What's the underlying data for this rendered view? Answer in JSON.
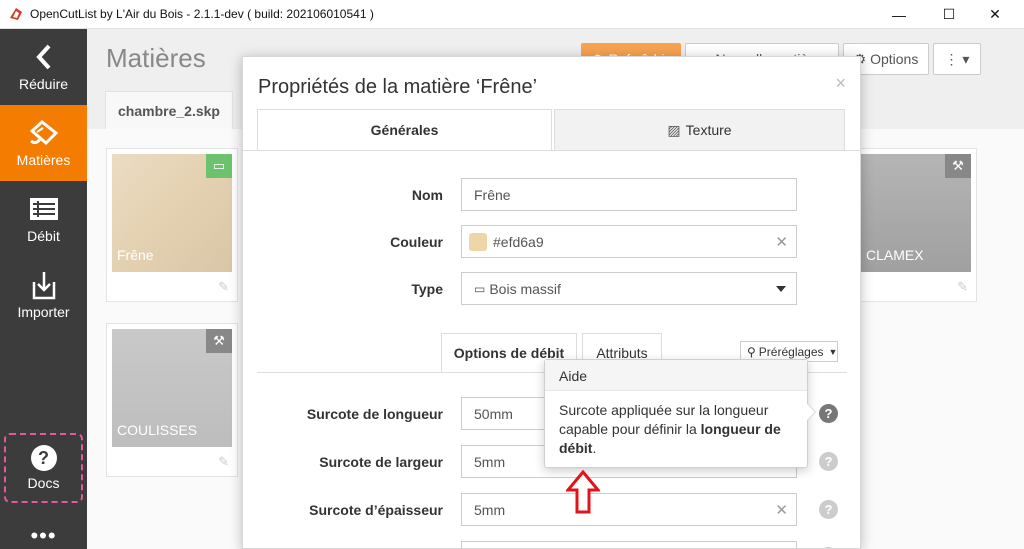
{
  "window": {
    "title": "OpenCutList by L'Air du Bois - 2.1.1-dev ( build: 202106010541 )",
    "controls": {
      "minimize": "—",
      "maximize": "☐",
      "close": "✕"
    }
  },
  "sidebar": {
    "items": [
      {
        "label": "Réduire",
        "icon": "chevron-left-icon"
      },
      {
        "label": "Matières",
        "icon": "materials-icon"
      },
      {
        "label": "Débit",
        "icon": "list-icon"
      },
      {
        "label": "Importer",
        "icon": "import-icon"
      }
    ],
    "docs_label": "Docs",
    "more_label": "•••"
  },
  "main": {
    "title": "Matières",
    "file_tab": "chambre_2.skp",
    "buttons": {
      "refresh": "⟳ Rafraîchir",
      "new_material": "+ Nouvelle matière",
      "options": "⚙ Options",
      "more": "⋮ ▾"
    },
    "cards": [
      {
        "name": "Frêne",
        "color": "#efd6a9"
      },
      {
        "name": "CLAMEX",
        "color": "#a8a8a8"
      },
      {
        "name": "COULISSES",
        "color": "#c6c6c6"
      }
    ]
  },
  "modal": {
    "title": "Propriétés de la matière ‘Frêne’",
    "close": "×",
    "tabs": {
      "general": "Générales",
      "texture": "Texture"
    },
    "fields": {
      "name_label": "Nom",
      "name_value": "Frêne",
      "color_label": "Couleur",
      "color_value": "#efd6a9",
      "type_label": "Type",
      "type_value": "Bois massif"
    },
    "subtabs": {
      "cut_options": "Options de débit",
      "attributes": "Attributs"
    },
    "presets": "Préréglages",
    "cut": {
      "length_label": "Surcote de longueur",
      "length_value": "50mm",
      "width_label": "Surcote de largeur",
      "width_value": "5mm",
      "thickness_label": "Surcote d’épaisseur",
      "thickness_value": "5mm"
    }
  },
  "popover": {
    "title": "Aide",
    "text_plain": "Surcote appliquée sur la longueur capable pour définir la ",
    "text_bold": "longueur de débit",
    "text_end": "."
  },
  "colors": {
    "sidebar": "#3c3c3c",
    "accent": "#f47c00",
    "swatch": "#efd6a9"
  }
}
